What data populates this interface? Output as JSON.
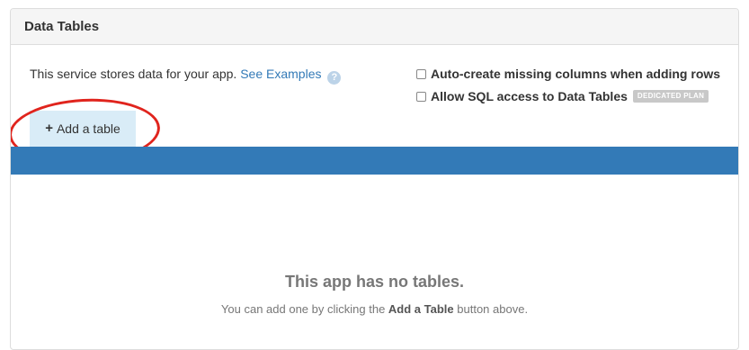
{
  "panel": {
    "title": "Data Tables"
  },
  "intro": {
    "text": "This service stores data for your app.",
    "link_label": "See Examples",
    "help_icon": "question-circle-icon"
  },
  "options": {
    "auto_create_label": "Auto-create missing columns when adding rows",
    "auto_create_checked": false,
    "sql_access_label": "Allow SQL access to Data Tables",
    "sql_access_checked": false,
    "sql_badge": "DEDICATED PLAN"
  },
  "toolbar": {
    "add_icon": "plus-icon",
    "add_label": "Add a table"
  },
  "empty_state": {
    "title": "This app has no tables.",
    "text_before": "You can add one by clicking the",
    "text_emphasis": "Add a Table",
    "text_after": "button above."
  },
  "colors": {
    "accent": "#337ab7",
    "button_bg": "#d9ecf7",
    "annotation": "#e0241d"
  }
}
